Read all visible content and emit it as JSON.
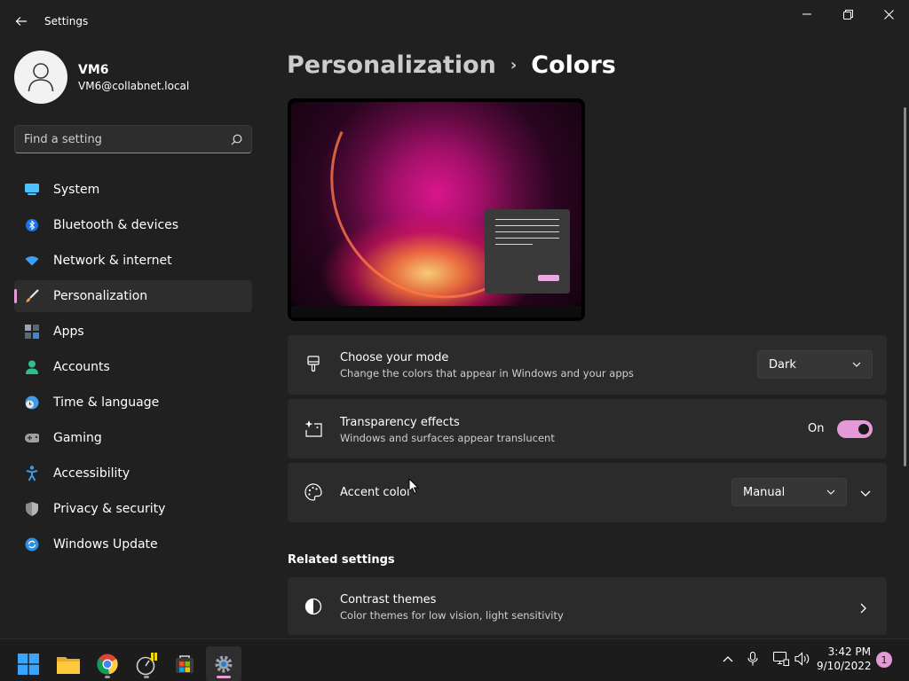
{
  "window": {
    "title": "Settings",
    "back_icon": "back-arrow-icon",
    "controls": [
      "minimize-icon",
      "restore-icon",
      "close-icon"
    ]
  },
  "profile": {
    "name": "VM6",
    "email": "VM6@collabnet.local"
  },
  "search": {
    "placeholder": "Find a setting"
  },
  "nav": {
    "items": [
      {
        "label": "System",
        "icon": "monitor-icon"
      },
      {
        "label": "Bluetooth & devices",
        "icon": "bluetooth-icon"
      },
      {
        "label": "Network & internet",
        "icon": "wifi-icon"
      },
      {
        "label": "Personalization",
        "icon": "paintbrush-icon",
        "selected": true
      },
      {
        "label": "Apps",
        "icon": "apps-icon"
      },
      {
        "label": "Accounts",
        "icon": "person-icon"
      },
      {
        "label": "Time & language",
        "icon": "clock-globe-icon"
      },
      {
        "label": "Gaming",
        "icon": "gamepad-icon"
      },
      {
        "label": "Accessibility",
        "icon": "accessibility-icon"
      },
      {
        "label": "Privacy & security",
        "icon": "shield-icon"
      },
      {
        "label": "Windows Update",
        "icon": "update-icon"
      }
    ]
  },
  "breadcrumb": {
    "parent": "Personalization",
    "separator": "›",
    "current": "Colors"
  },
  "settings": {
    "mode": {
      "title": "Choose your mode",
      "description": "Change the colors that appear in Windows and your apps",
      "value": "Dark"
    },
    "transparency": {
      "title": "Transparency effects",
      "description": "Windows and surfaces appear translucent",
      "state_label": "On"
    },
    "accent": {
      "title": "Accent color",
      "value": "Manual"
    }
  },
  "related": {
    "heading": "Related settings",
    "contrast": {
      "title": "Contrast themes",
      "description": "Color themes for low vision, light sensitivity"
    }
  },
  "taskbar": {
    "apps": [
      "windows-start-icon",
      "file-explorer-icon",
      "chrome-icon",
      "tool-icon",
      "store-icon",
      "settings-gear-icon"
    ],
    "tray": [
      "chevron-up-icon",
      "microphone-icon",
      "network-icon",
      "volume-icon"
    ],
    "time": "3:42 PM",
    "date": "9/10/2022",
    "notification_count": "1"
  },
  "colors": {
    "accent": "#e59ad8",
    "background": "#202020",
    "card": "#2b2b2b"
  }
}
